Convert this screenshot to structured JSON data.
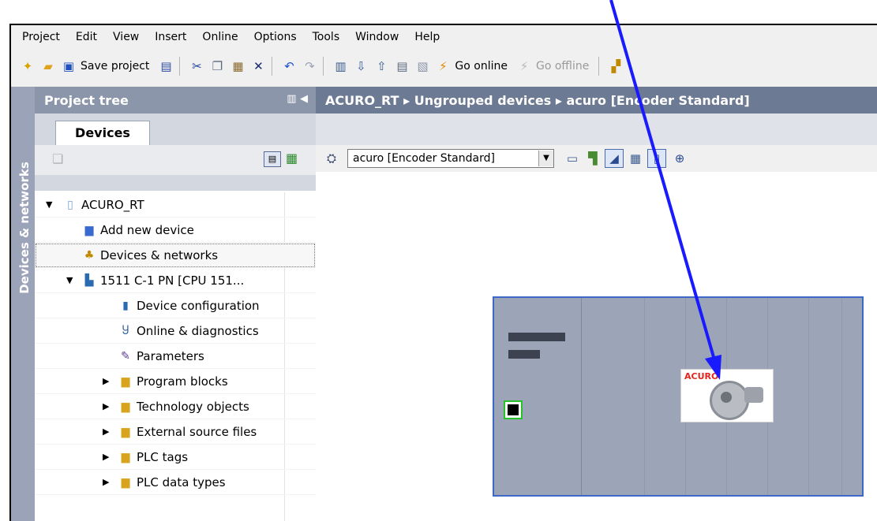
{
  "menu": [
    "Project",
    "Edit",
    "View",
    "Insert",
    "Online",
    "Options",
    "Tools",
    "Window",
    "Help"
  ],
  "toolbar": {
    "save_project": "Save project",
    "go_online": "Go online",
    "go_offline": "Go offline"
  },
  "sidebar_strip": "Devices & networks",
  "project_tree": {
    "header": "Project tree",
    "tab": "Devices",
    "items": [
      {
        "label": "ACURO_RT",
        "icon": "project-icon"
      },
      {
        "label": "Add new device",
        "icon": "add-device-icon"
      },
      {
        "label": "Devices & networks",
        "icon": "network-icon"
      },
      {
        "label": "1511 C-1 PN [CPU 151...",
        "icon": "cpu-icon"
      },
      {
        "label": "Device configuration",
        "icon": "device-config-icon"
      },
      {
        "label": "Online & diagnostics",
        "icon": "diagnostics-icon"
      },
      {
        "label": "Parameters",
        "icon": "parameters-icon"
      },
      {
        "label": "Program blocks",
        "icon": "folder-icon"
      },
      {
        "label": "Technology objects",
        "icon": "folder-icon"
      },
      {
        "label": "External source files",
        "icon": "folder-icon"
      },
      {
        "label": "PLC tags",
        "icon": "folder-icon"
      },
      {
        "label": "PLC data types",
        "icon": "folder-icon"
      }
    ]
  },
  "editor": {
    "breadcrumb": [
      "ACURO_RT",
      "Ungrouped devices",
      "acuro [Encoder Standard]"
    ],
    "device_select": "acuro [Encoder Standard]",
    "device_tag": "acuro",
    "thumbnail_brand": "ACURO"
  },
  "colors": {
    "annotation_arrow": "#1a1aff",
    "rack_border": "#3e68c8",
    "device_tag": "#1f54c4"
  }
}
